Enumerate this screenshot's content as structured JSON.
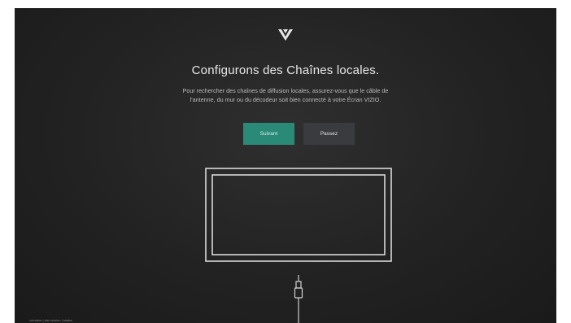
{
  "screen": {
    "logo": "vizio-chevron-icon",
    "title": "Configurons des Chaînes locales.",
    "description_line1": "Pour rechercher des chaînes de diffusion locales, assurez-vous que le câble de",
    "description_line2": "l'antenne, du mur ou du décodeur soit bien connecté à votre Écran VIZIO.",
    "buttons": {
      "next_label": "Suivant",
      "skip_label": "Passez"
    },
    "illustration": {
      "tv": "tv-outline-icon",
      "cable": "coax-cable-icon"
    },
    "footer_text": "cmodem  |  sfw version  |  ssaba"
  },
  "colors": {
    "background": "#262626",
    "accent": "#2a8a78",
    "secondary_button": "#393b3f",
    "text": "#e8e8e8"
  }
}
